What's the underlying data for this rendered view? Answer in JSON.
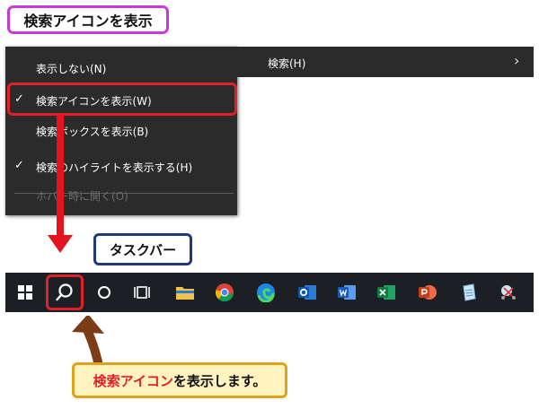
{
  "title_callout": "検索アイコンを表示",
  "menu": {
    "items": [
      {
        "label": "表示しない(N)",
        "checked": false,
        "disabled": false
      },
      {
        "label": "検索アイコンを表示(W)",
        "checked": true,
        "disabled": false
      },
      {
        "label": "検索ボックスを表示(B)",
        "checked": false,
        "disabled": false
      },
      {
        "label": "検索のハイライトを表示する(H)",
        "checked": true,
        "disabled": false
      },
      {
        "label": "ホバー時に開く(O)",
        "checked": false,
        "disabled": true
      }
    ],
    "check_glyph": "✓"
  },
  "submenu": {
    "label": "検索(H)",
    "chevron": "›"
  },
  "taskbar_callout": "タスクバー",
  "taskbar": {
    "icons": [
      "windows-start-icon",
      "search-icon",
      "cortana-icon",
      "task-view-icon",
      "file-explorer-icon",
      "chrome-icon",
      "edge-icon",
      "outlook-icon",
      "word-icon",
      "excel-icon",
      "powerpoint-icon",
      "notepad-icon",
      "snipping-tool-icon"
    ]
  },
  "bottom_callout": {
    "red_text": "検索アイコン",
    "black_text": "を表示します。"
  },
  "colors": {
    "accent_red": "#e0202a",
    "callout_title_border": "#c63bd6",
    "taskbar_callout_border": "#1f3a7a",
    "bottom_callout_border": "#e0a21a"
  }
}
